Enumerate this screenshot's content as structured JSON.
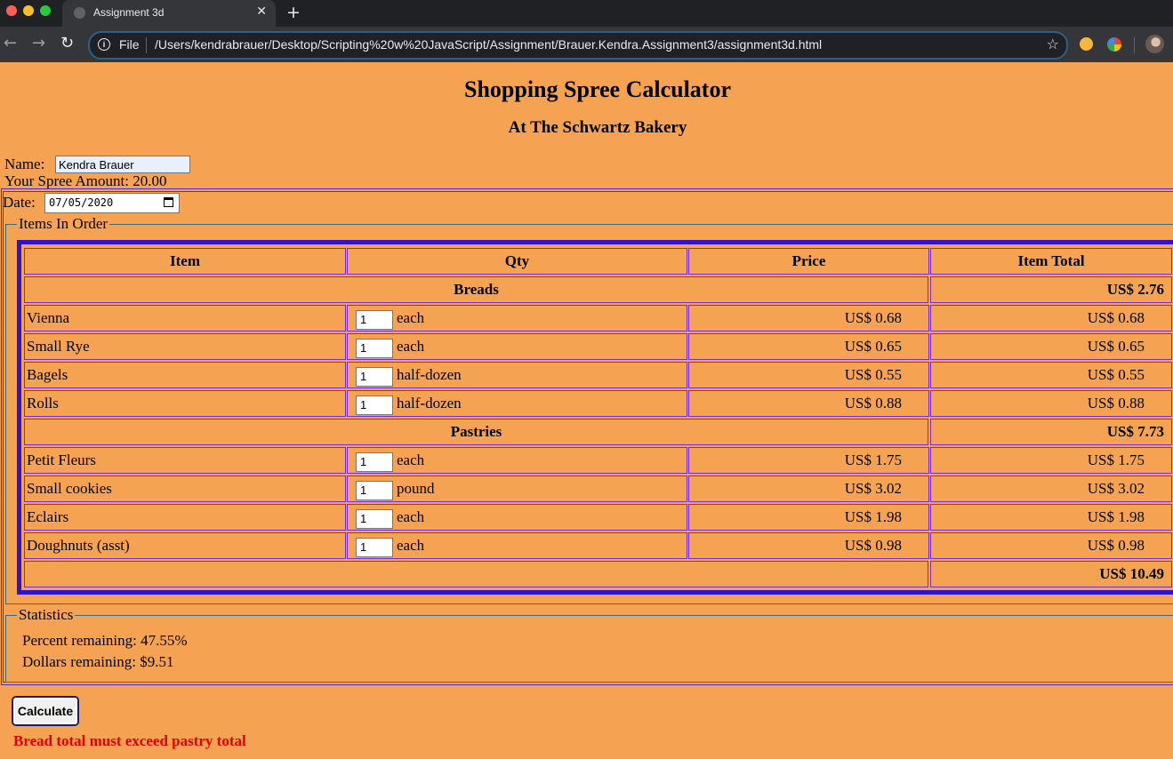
{
  "browser": {
    "tab_title": "Assignment 3d",
    "tab_close": "✕",
    "new_tab": "+",
    "back": "←",
    "forward": "→",
    "reload": "↻",
    "info_icon": "i",
    "file_label": "File",
    "url": "/Users/kendrabrauer/Desktop/Scripting%20w%20JavaScript/Assignment/Brauer.Kendra.Assignment3/assignment3d.html",
    "star": "☆"
  },
  "page": {
    "title": "Shopping Spree Calculator",
    "subtitle": "At The Schwartz Bakery",
    "name_label": "Name:",
    "name_value": "Kendra Brauer",
    "spree_amount_text": "Your Spree Amount: 20.00",
    "date_label": "Date:",
    "date_value": "07/05/2020"
  },
  "order": {
    "legend": "Items In Order",
    "headers": [
      "Item",
      "Qty",
      "Price",
      "Item Total"
    ],
    "categories": [
      {
        "name": "Breads",
        "total": "US$ 2.76",
        "items": [
          {
            "name": "Vienna",
            "qty": "1",
            "unit": "each",
            "price": "US$ 0.68",
            "total": "US$ 0.68"
          },
          {
            "name": "Small Rye",
            "qty": "1",
            "unit": "each",
            "price": "US$ 0.65",
            "total": "US$ 0.65"
          },
          {
            "name": "Bagels",
            "qty": "1",
            "unit": "half-dozen",
            "price": "US$ 0.55",
            "total": "US$ 0.55"
          },
          {
            "name": "Rolls",
            "qty": "1",
            "unit": "half-dozen",
            "price": "US$ 0.88",
            "total": "US$ 0.88"
          }
        ]
      },
      {
        "name": "Pastries",
        "total": "US$ 7.73",
        "items": [
          {
            "name": "Petit Fleurs",
            "qty": "1",
            "unit": "each",
            "price": "US$ 1.75",
            "total": "US$ 1.75"
          },
          {
            "name": "Small cookies",
            "qty": "1",
            "unit": "pound",
            "price": "US$ 3.02",
            "total": "US$ 3.02"
          },
          {
            "name": "Eclairs",
            "qty": "1",
            "unit": "each",
            "price": "US$ 1.98",
            "total": "US$ 1.98"
          },
          {
            "name": "Doughnuts (asst)",
            "qty": "1",
            "unit": "each",
            "price": "US$ 0.98",
            "total": "US$ 0.98"
          }
        ]
      }
    ],
    "grand_total": "US$ 10.49"
  },
  "statistics": {
    "legend": "Statistics",
    "percent_remaining": "Percent remaining: 47.55%",
    "dollars_remaining": "Dollars remaining: $9.51"
  },
  "actions": {
    "calculate_label": "Calculate"
  },
  "error_message": "Bread total must exceed pastry total",
  "colors": {
    "page_background": "#f5a352",
    "table_border": "#2f13ce",
    "cell_border": "#7a2bd0",
    "error_text": "#e00000"
  }
}
